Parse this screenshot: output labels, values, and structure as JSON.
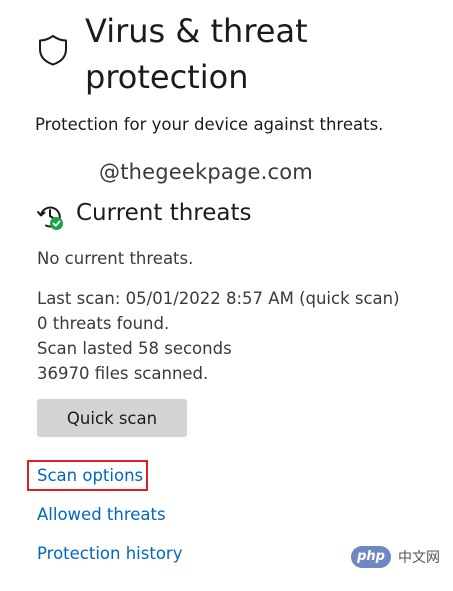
{
  "header": {
    "title": "Virus & threat protection",
    "subtitle": "Protection for your device against threats.",
    "icon": "shield-icon"
  },
  "watermark": "@thegeekpage.com",
  "current_threats": {
    "title": "Current threats",
    "icon": "history-check-icon",
    "status_lines": [
      "No current threats.",
      "Last scan: 05/01/2022 8:57 AM (quick scan)",
      "0 threats found.",
      "Scan lasted 58 seconds",
      "36970 files scanned."
    ],
    "quick_scan_label": "Quick scan"
  },
  "links": {
    "scan_options": "Scan options",
    "allowed_threats": "Allowed threats",
    "protection_history": "Protection history"
  },
  "corner_watermark": {
    "badge": "php",
    "site": "中文网"
  },
  "colors": {
    "link": "#0067c0",
    "highlight": "#e0201c",
    "button": "#d4d4d4",
    "check_badge": "#16a34a"
  }
}
